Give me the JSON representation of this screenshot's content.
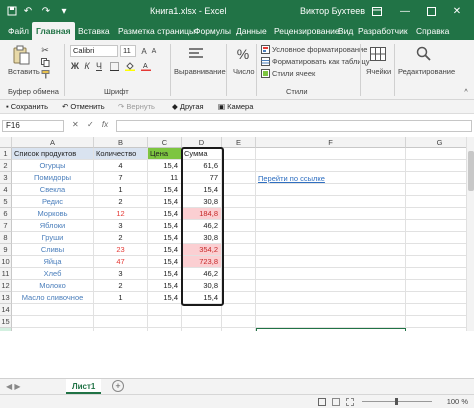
{
  "window": {
    "title": "Книга1.xlsx  -  Excel",
    "user": "Виктор Бухтеев"
  },
  "tabs": [
    "Файл",
    "Главная",
    "Вставка",
    "Разметка страницы",
    "Формулы",
    "Данные",
    "Рецензирование",
    "Вид",
    "Разработчик",
    "Справка"
  ],
  "ribbon": {
    "paste": "Вставить",
    "clipboard_group": "Буфер обмена",
    "font_name": "Calibri",
    "font_size": "11",
    "font_group": "Шрифт",
    "alignment": "Выравнивание",
    "number": "Число",
    "cond_format": "Условное форматирование",
    "format_table": "Форматировать как таблицу",
    "cell_styles": "Стили ячеек",
    "styles_group": "Стили",
    "cells": "Ячейки",
    "editing": "Редактирование"
  },
  "qat": {
    "save": "Сохранить",
    "undo": "Отменить",
    "redo": "Вернуть",
    "other": "Другая",
    "camera": "Камера"
  },
  "formula_bar": {
    "name_box": "F16",
    "value": ""
  },
  "grid": {
    "columns": [
      "A",
      "B",
      "C",
      "D",
      "E",
      "F",
      "G"
    ],
    "rows": [
      "1",
      "2",
      "3",
      "4",
      "5",
      "6",
      "7",
      "8",
      "9",
      "10",
      "11",
      "12",
      "13",
      "14",
      "15",
      "16",
      "17",
      "18"
    ],
    "headers": [
      "Список продуктов",
      "Количество",
      "Цена",
      "Сумма"
    ],
    "data": [
      [
        "Огурцы",
        "4",
        "15,4",
        "61,6"
      ],
      [
        "Помидоры",
        "7",
        "11",
        "77"
      ],
      [
        "Свекла",
        "1",
        "15,4",
        "15,4"
      ],
      [
        "Редис",
        "2",
        "15,4",
        "30,8"
      ],
      [
        "Морковь",
        "12",
        "15,4",
        "184,8"
      ],
      [
        "Яблоки",
        "3",
        "15,4",
        "46,2"
      ],
      [
        "Груши",
        "2",
        "15,4",
        "30,8"
      ],
      [
        "Сливы",
        "23",
        "15,4",
        "354,2"
      ],
      [
        "Яйца",
        "47",
        "15,4",
        "723,8"
      ],
      [
        "Хлеб",
        "3",
        "15,4",
        "46,2"
      ],
      [
        "Молоко",
        "2",
        "15,4",
        "30,8"
      ],
      [
        "Масло сливочное",
        "1",
        "15,4",
        "15,4"
      ]
    ],
    "link_text": "Перейти по ссылке"
  },
  "sheet_tab": "Лист1",
  "status": {
    "zoom": "100 %"
  },
  "colors": {
    "brand": "#217346",
    "header_blue": "#d9e3f0",
    "price_green": "#7dc540",
    "highlight_pink": "#fbcfd2",
    "red_text": "#e53935"
  }
}
